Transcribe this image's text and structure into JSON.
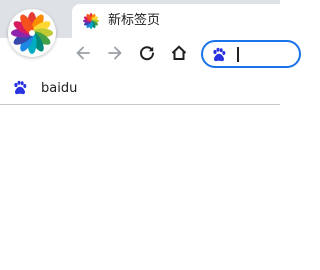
{
  "tab": {
    "title": "新标签页",
    "favicon": "chromium-pinwheel-icon"
  },
  "toolbar": {
    "back_icon": "back-arrow-icon",
    "forward_icon": "forward-arrow-icon",
    "reload_icon": "reload-icon",
    "home_icon": "home-icon"
  },
  "omnibox": {
    "value": "",
    "search_engine_icon": "baidu-paw-icon",
    "accent_color": "#1a73e8"
  },
  "bookmarks": [
    {
      "label": "baidu",
      "icon": "baidu-paw-icon"
    }
  ],
  "colors": {
    "titlebar": "#dee1e6",
    "baidu_blue": "#2932e1",
    "icon_gray": "#5f6368",
    "icon_dark": "#202124"
  }
}
